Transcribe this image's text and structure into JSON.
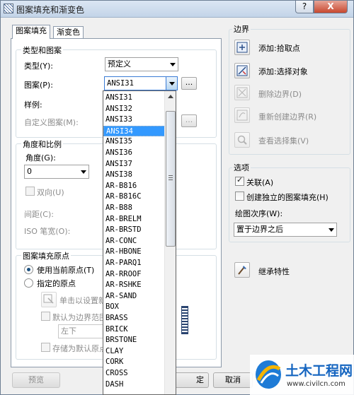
{
  "window": {
    "title": "图案填充和渐变色",
    "help_label": "?",
    "close_label": "X"
  },
  "tabs": [
    {
      "label": "图案填充"
    },
    {
      "label": "渐变色"
    }
  ],
  "type_pattern": {
    "group_label": "类型和图案",
    "type_label": "类型(Y):",
    "type_value": "预定义",
    "pattern_label": "图案(P):",
    "pattern_value": "ANSI31",
    "browse_label": "...",
    "swatch_label": "样例:",
    "custom_label": "自定义图案(M):",
    "custom_browse_label": "..."
  },
  "angle_scale": {
    "group_label": "角度和比例",
    "angle_label": "角度(G):",
    "angle_value": "0",
    "double_label": "双向(U)",
    "spacing_label": "间距(C):",
    "iso_label": "ISO 笔宽(O):"
  },
  "origin": {
    "group_label": "图案填充原点",
    "use_current_label": "使用当前原点(T)",
    "specified_label": "指定的原点",
    "click_set_label": "单击以设置新",
    "default_boundary_label": "默认为边界范围",
    "position_value": "左下",
    "store_default_label": "存储为默认原点"
  },
  "boundary": {
    "group_label": "边界",
    "add_pick_label": "添加:拾取点",
    "add_select_label": "添加:选择对象",
    "remove_label": "删除边界(D)",
    "recreate_label": "重新创建边界(R)",
    "view_label": "查看选择集(V)"
  },
  "options": {
    "group_label": "选项",
    "associative_label": "关联(A)",
    "associative_checked": true,
    "separate_label": "创建独立的图案填充(H)",
    "separate_checked": false,
    "draw_order_label": "绘图次序(W):",
    "draw_order_value": "置于边界之后"
  },
  "inherit": {
    "label": "继承特性"
  },
  "footer": {
    "preview_label": "预览",
    "ok_label": "定",
    "cancel_label": "取消"
  },
  "pattern_dropdown": {
    "selected": "ANSI34",
    "items": [
      "ANSI31",
      "ANSI32",
      "ANSI33",
      "ANSI34",
      "ANSI35",
      "ANSI36",
      "ANSI37",
      "ANSI38",
      "AR-B816",
      "AR-B816C",
      "AR-B88",
      "AR-BRELM",
      "AR-BRSTD",
      "AR-CONC",
      "AR-HBONE",
      "AR-PARQ1",
      "AR-RROOF",
      "AR-RSHKE",
      "AR-SAND",
      "BOX",
      "BRASS",
      "BRICK",
      "BRSTONE",
      "CLAY",
      "CORK",
      "CROSS",
      "DASH"
    ]
  },
  "watermark": {
    "brand": "土木工程网",
    "url": "www.civilcn.com"
  }
}
